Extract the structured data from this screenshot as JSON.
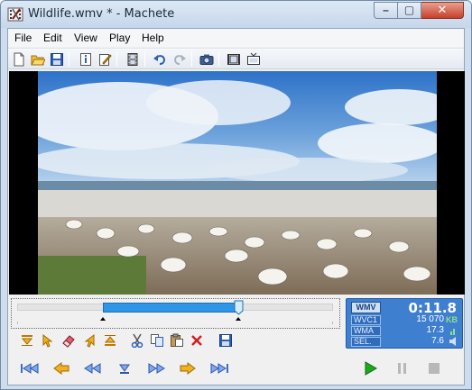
{
  "window": {
    "title": "Wildlife.wmv * - Machete",
    "minimize": "–",
    "maximize": "▢",
    "close": "✕"
  },
  "menu": [
    "File",
    "Edit",
    "View",
    "Play",
    "Help"
  ],
  "toolbar": [
    {
      "name": "new-file-icon"
    },
    {
      "name": "open-folder-icon"
    },
    {
      "name": "save-icon"
    },
    {
      "name": "file-info-icon"
    },
    {
      "name": "edit-tags-icon"
    },
    {
      "name": "film-properties-icon"
    },
    {
      "name": "undo-icon"
    },
    {
      "name": "redo-icon"
    },
    {
      "name": "snapshot-camera-icon"
    },
    {
      "name": "video-frames-icon"
    },
    {
      "name": "tv-preview-icon"
    }
  ],
  "timeline": {
    "selection_start": 0.27,
    "selection_end": 0.7,
    "position": 0.7
  },
  "edit_toolbar": [
    {
      "name": "mark-in-icon"
    },
    {
      "name": "select-to-start-icon"
    },
    {
      "name": "eraser-icon"
    },
    {
      "name": "select-to-end-icon"
    },
    {
      "name": "mark-out-icon"
    },
    {
      "name": "cut-icon"
    },
    {
      "name": "copy-icon"
    },
    {
      "name": "paste-icon"
    },
    {
      "name": "delete-icon"
    },
    {
      "name": "save-selection-icon"
    }
  ],
  "transport": [
    {
      "name": "go-to-start-icon"
    },
    {
      "name": "previous-keyframe-icon"
    },
    {
      "name": "rewind-icon"
    },
    {
      "name": "current-position-icon"
    },
    {
      "name": "fast-forward-icon"
    },
    {
      "name": "next-keyframe-icon"
    },
    {
      "name": "go-to-end-icon"
    },
    {
      "name": "play-icon"
    },
    {
      "name": "pause-icon"
    },
    {
      "name": "stop-icon"
    }
  ],
  "info": {
    "format": "WMV",
    "time": "0:11.8",
    "video_codec": "WVC1",
    "file_size": "15 070",
    "size_unit": "KB",
    "audio_codec": "WMA",
    "audio_value": "17.3",
    "sel_label": "SEL.",
    "sel_value": "7.6"
  },
  "colors": {
    "selection": "#2f95e6",
    "info_panel": "#3f7fd0",
    "play": "#1ea81e",
    "transport_blue": "#3a6fd0",
    "transport_yellow": "#f0b020"
  }
}
